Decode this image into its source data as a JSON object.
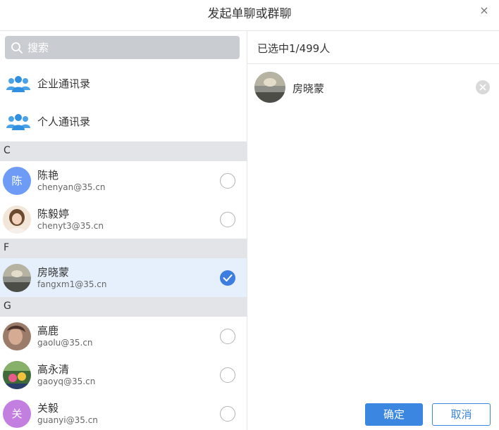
{
  "dialog": {
    "title": "发起单聊或群聊",
    "close_label": "×"
  },
  "search": {
    "placeholder": "搜索"
  },
  "directories": [
    {
      "label": "企业通讯录",
      "icon": "people-group-icon"
    },
    {
      "label": "个人通讯录",
      "icon": "people-group-icon"
    }
  ],
  "sections": [
    {
      "letter": "C"
    },
    {
      "letter": "F"
    },
    {
      "letter": "G"
    }
  ],
  "contacts": [
    {
      "name": "陈艳",
      "email": "chenyan@35.cn",
      "avatar_text": "陈",
      "selected": false
    },
    {
      "name": "陈毅婷",
      "email": "chenyt3@35.cn",
      "avatar_text": "",
      "selected": false
    },
    {
      "name": "房晓蒙",
      "email": "fangxm1@35.cn",
      "avatar_text": "",
      "selected": true
    },
    {
      "name": "高鹿",
      "email": "gaolu@35.cn",
      "avatar_text": "",
      "selected": false
    },
    {
      "name": "高永清",
      "email": "gaoyq@35.cn",
      "avatar_text": "",
      "selected": false
    },
    {
      "name": "关毅",
      "email": "guanyi@35.cn",
      "avatar_text": "关",
      "selected": false
    }
  ],
  "selection": {
    "header": "已选中1/499人",
    "items": [
      {
        "name": "房晓蒙"
      }
    ]
  },
  "buttons": {
    "confirm": "确定",
    "cancel": "取消"
  },
  "colors": {
    "accent": "#3b86e0",
    "selected_row": "#e5f0fc",
    "section_bg": "#e2e4e7",
    "search_bg": "#c9ccd1"
  }
}
